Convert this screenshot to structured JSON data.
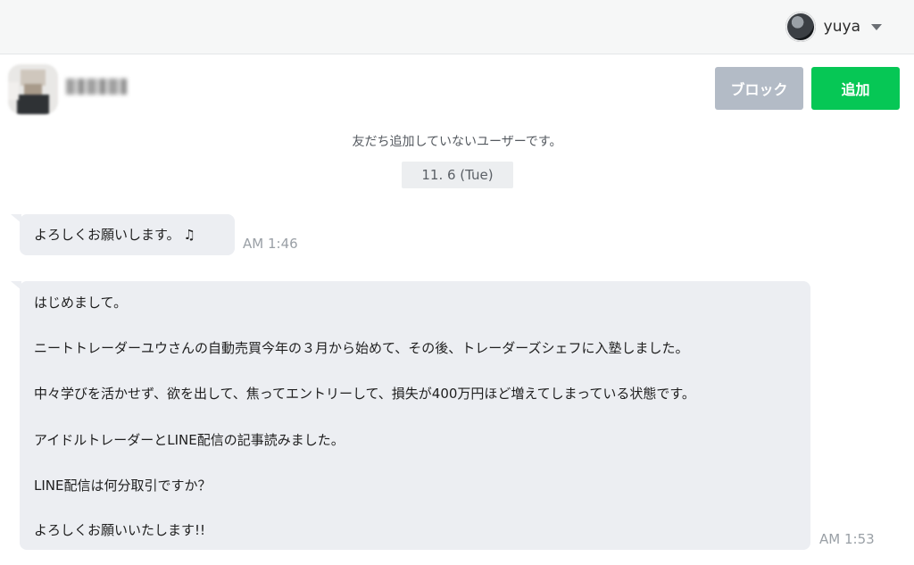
{
  "header": {
    "user_name": "yuya",
    "icons": {
      "avatar": "user-avatar-icon",
      "dropdown": "caret-down-icon"
    }
  },
  "contact": {
    "block_label": "ブロック",
    "add_label": "追加",
    "colors": {
      "block": "#b3bbc6",
      "add": "#06c755"
    }
  },
  "chat": {
    "notice": "友だち追加していないユーザーです。",
    "date": "11. 6 (Tue)",
    "messages": [
      {
        "text": "よろしくお願いします。",
        "icon": "♫",
        "time": "AM 1:46"
      },
      {
        "lines": [
          "はじめまして。",
          "ニートトレーダーユウさんの自動売買今年の３月から始めて、その後、トレーダーズシェフに入塾しました。",
          "中々学びを活かせず、欲を出して、焦ってエントリーして、損失が400万円ほど増えてしまっている状態です。",
          "アイドルトレーダーとLINE配信の記事読みました。",
          "LINE配信は何分取引ですか？",
          "よろしくお願いいたします!!"
        ],
        "time": "AM 1:53"
      }
    ]
  }
}
